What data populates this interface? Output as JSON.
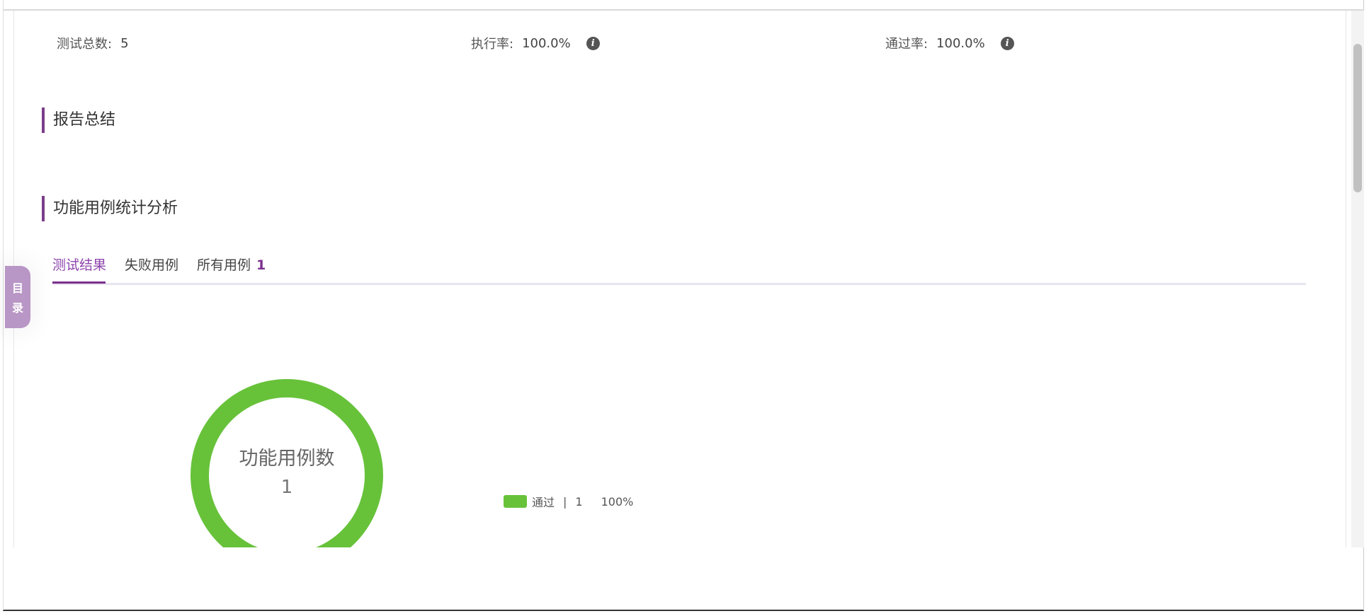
{
  "stats": {
    "total_label": "测试总数:",
    "total_value": "5",
    "exec_label": "执行率:",
    "exec_value": "100.0%",
    "pass_label": "通过率:",
    "pass_value": "100.0%"
  },
  "sections": {
    "summary_title": "报告总结",
    "analysis_title": "功能用例统计分析"
  },
  "tabs": [
    {
      "label": "测试结果",
      "active": true
    },
    {
      "label": "失败用例",
      "active": false
    },
    {
      "label": "所有用例",
      "count": "1",
      "active": false
    }
  ],
  "toc": {
    "char1": "目",
    "char2": "录"
  },
  "chart_data": {
    "type": "pie",
    "title": "功能用例数",
    "center_value": "1",
    "slices": [
      {
        "name": "通过",
        "value": 1,
        "percent": "100%",
        "color": "#67c23a"
      }
    ],
    "legend": {
      "name": "通过",
      "sep": "|",
      "value": "1",
      "percent": "100%"
    }
  },
  "colors": {
    "accent": "#7b2f8f",
    "pass": "#67c23a",
    "toc_bg": "#b896c5"
  }
}
